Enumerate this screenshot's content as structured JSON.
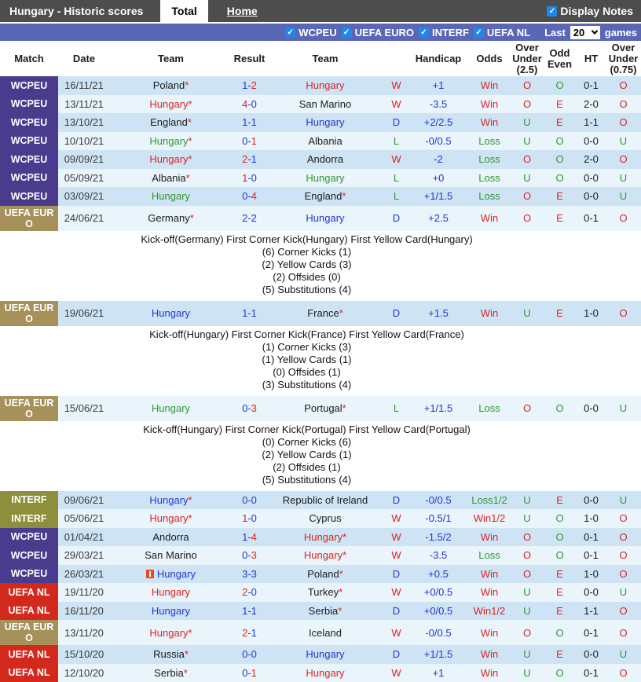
{
  "titlebar": {
    "title": "Hungary - Historic scores",
    "tabs": [
      {
        "label": "Total",
        "active": true
      },
      {
        "label": "Home",
        "active": false
      }
    ],
    "display_notes_label": "Display Notes",
    "display_notes_checked": true
  },
  "filterbar": {
    "leagues": [
      {
        "label": "WCPEU",
        "checked": true
      },
      {
        "label": "UEFA EURO",
        "checked": true
      },
      {
        "label": "INTERF",
        "checked": true
      },
      {
        "label": "UEFA NL",
        "checked": true
      }
    ],
    "last_label": "Last",
    "last_value": "20",
    "games_label": "games"
  },
  "table": {
    "headers": [
      "Match",
      "Date",
      "Team",
      "Result",
      "Team",
      "",
      "Handicap",
      "Odds",
      "Over Under (2.5)",
      "Odd Even",
      "HT",
      "Over Under (0.75)"
    ],
    "rows": [
      {
        "league": "WCPEU",
        "date": "16/11/21",
        "team1": {
          "name": "Poland",
          "color": "black",
          "star": true
        },
        "score": {
          "s1": "1",
          "s2": "2",
          "c1": "blue",
          "c2": "red"
        },
        "team2": {
          "name": "Hungary",
          "color": "red",
          "star": false
        },
        "wdl": {
          "t": "W",
          "c": "red"
        },
        "handicap": "+1",
        "odds": {
          "t": "Win",
          "c": "red"
        },
        "ou25": {
          "t": "O",
          "c": "red"
        },
        "oe": {
          "t": "O",
          "c": "green"
        },
        "ht": "0-1",
        "ou075": {
          "t": "O",
          "c": "red"
        }
      },
      {
        "league": "WCPEU",
        "date": "13/11/21",
        "team1": {
          "name": "Hungary",
          "color": "red",
          "star": true
        },
        "score": {
          "s1": "4",
          "s2": "0",
          "c1": "red",
          "c2": "blue"
        },
        "team2": {
          "name": "San Marino",
          "color": "black",
          "star": false
        },
        "wdl": {
          "t": "W",
          "c": "red"
        },
        "handicap": "-3.5",
        "odds": {
          "t": "Win",
          "c": "red"
        },
        "ou25": {
          "t": "O",
          "c": "red"
        },
        "oe": {
          "t": "E",
          "c": "red"
        },
        "ht": "2-0",
        "ou075": {
          "t": "O",
          "c": "red"
        }
      },
      {
        "league": "WCPEU",
        "date": "13/10/21",
        "team1": {
          "name": "England",
          "color": "black",
          "star": true
        },
        "score": {
          "s1": "1",
          "s2": "1",
          "c1": "blue",
          "c2": "blue"
        },
        "team2": {
          "name": "Hungary",
          "color": "blue",
          "star": false
        },
        "wdl": {
          "t": "D",
          "c": "blue"
        },
        "handicap": "+2/2.5",
        "odds": {
          "t": "Win",
          "c": "red"
        },
        "ou25": {
          "t": "U",
          "c": "green"
        },
        "oe": {
          "t": "E",
          "c": "red"
        },
        "ht": "1-1",
        "ou075": {
          "t": "O",
          "c": "red"
        }
      },
      {
        "league": "WCPEU",
        "date": "10/10/21",
        "team1": {
          "name": "Hungary",
          "color": "green",
          "star": true
        },
        "score": {
          "s1": "0",
          "s2": "1",
          "c1": "blue",
          "c2": "red"
        },
        "team2": {
          "name": "Albania",
          "color": "black",
          "star": false
        },
        "wdl": {
          "t": "L",
          "c": "green"
        },
        "handicap": "-0/0.5",
        "odds": {
          "t": "Loss",
          "c": "green"
        },
        "ou25": {
          "t": "U",
          "c": "green"
        },
        "oe": {
          "t": "O",
          "c": "green"
        },
        "ht": "0-0",
        "ou075": {
          "t": "U",
          "c": "green"
        }
      },
      {
        "league": "WCPEU",
        "date": "09/09/21",
        "team1": {
          "name": "Hungary",
          "color": "red",
          "star": true
        },
        "score": {
          "s1": "2",
          "s2": "1",
          "c1": "red",
          "c2": "blue"
        },
        "team2": {
          "name": "Andorra",
          "color": "black",
          "star": false
        },
        "wdl": {
          "t": "W",
          "c": "red"
        },
        "handicap": "-2",
        "odds": {
          "t": "Loss",
          "c": "green"
        },
        "ou25": {
          "t": "O",
          "c": "red"
        },
        "oe": {
          "t": "O",
          "c": "green"
        },
        "ht": "2-0",
        "ou075": {
          "t": "O",
          "c": "red"
        }
      },
      {
        "league": "WCPEU",
        "date": "05/09/21",
        "team1": {
          "name": "Albania",
          "color": "black",
          "star": true
        },
        "score": {
          "s1": "1",
          "s2": "0",
          "c1": "red",
          "c2": "blue"
        },
        "team2": {
          "name": "Hungary",
          "color": "green",
          "star": false
        },
        "wdl": {
          "t": "L",
          "c": "green"
        },
        "handicap": "+0",
        "odds": {
          "t": "Loss",
          "c": "green"
        },
        "ou25": {
          "t": "U",
          "c": "green"
        },
        "oe": {
          "t": "O",
          "c": "green"
        },
        "ht": "0-0",
        "ou075": {
          "t": "U",
          "c": "green"
        }
      },
      {
        "league": "WCPEU",
        "date": "03/09/21",
        "team1": {
          "name": "Hungary",
          "color": "green",
          "star": false
        },
        "score": {
          "s1": "0",
          "s2": "4",
          "c1": "blue",
          "c2": "red"
        },
        "team2": {
          "name": "England",
          "color": "black",
          "star": true
        },
        "wdl": {
          "t": "L",
          "c": "green"
        },
        "handicap": "+1/1.5",
        "odds": {
          "t": "Loss",
          "c": "green"
        },
        "ou25": {
          "t": "O",
          "c": "red"
        },
        "oe": {
          "t": "E",
          "c": "red"
        },
        "ht": "0-0",
        "ou075": {
          "t": "U",
          "c": "green"
        }
      },
      {
        "league": "UEFA EURO",
        "date": "24/06/21",
        "team1": {
          "name": "Germany",
          "color": "black",
          "star": true
        },
        "score": {
          "s1": "2",
          "s2": "2",
          "c1": "blue",
          "c2": "blue"
        },
        "team2": {
          "name": "Hungary",
          "color": "blue",
          "star": false
        },
        "wdl": {
          "t": "D",
          "c": "blue"
        },
        "handicap": "+2.5",
        "odds": {
          "t": "Win",
          "c": "red"
        },
        "ou25": {
          "t": "O",
          "c": "red"
        },
        "oe": {
          "t": "E",
          "c": "red"
        },
        "ht": "0-1",
        "ou075": {
          "t": "O",
          "c": "red"
        },
        "note": {
          "header": "Kick-off(Germany)  First Corner Kick(Hungary)  First Yellow Card(Hungary)",
          "lines": [
            "(6) Corner Kicks (1)",
            "(2) Yellow Cards (3)",
            "(2) Offsides (0)",
            "(5) Substitutions (4)"
          ]
        }
      },
      {
        "league": "UEFA EURO",
        "date": "19/06/21",
        "team1": {
          "name": "Hungary",
          "color": "blue",
          "star": false
        },
        "score": {
          "s1": "1",
          "s2": "1",
          "c1": "blue",
          "c2": "blue"
        },
        "team2": {
          "name": "France",
          "color": "black",
          "star": true
        },
        "wdl": {
          "t": "D",
          "c": "blue"
        },
        "handicap": "+1.5",
        "odds": {
          "t": "Win",
          "c": "red"
        },
        "ou25": {
          "t": "U",
          "c": "green"
        },
        "oe": {
          "t": "E",
          "c": "red"
        },
        "ht": "1-0",
        "ou075": {
          "t": "O",
          "c": "red"
        },
        "note": {
          "header": "Kick-off(Hungary)  First Corner Kick(France)  First Yellow Card(France)",
          "lines": [
            "(1) Corner Kicks (3)",
            "(1) Yellow Cards (1)",
            "(0) Offsides (1)",
            "(3) Substitutions (4)"
          ]
        }
      },
      {
        "league": "UEFA EURO",
        "date": "15/06/21",
        "team1": {
          "name": "Hungary",
          "color": "green",
          "star": false
        },
        "score": {
          "s1": "0",
          "s2": "3",
          "c1": "blue",
          "c2": "red"
        },
        "team2": {
          "name": "Portugal",
          "color": "black",
          "star": true
        },
        "wdl": {
          "t": "L",
          "c": "green"
        },
        "handicap": "+1/1.5",
        "odds": {
          "t": "Loss",
          "c": "green"
        },
        "ou25": {
          "t": "O",
          "c": "red"
        },
        "oe": {
          "t": "O",
          "c": "green"
        },
        "ht": "0-0",
        "ou075": {
          "t": "U",
          "c": "green"
        },
        "note": {
          "header": "Kick-off(Hungary)  First Corner Kick(Portugal)  First Yellow Card(Portugal)",
          "lines": [
            "(0) Corner Kicks (6)",
            "(2) Yellow Cards (1)",
            "(2) Offsides (1)",
            "(5) Substitutions (4)"
          ]
        }
      },
      {
        "league": "INTERF",
        "date": "09/06/21",
        "team1": {
          "name": "Hungary",
          "color": "blue",
          "star": true
        },
        "score": {
          "s1": "0",
          "s2": "0",
          "c1": "blue",
          "c2": "blue"
        },
        "team2": {
          "name": "Republic of Ireland",
          "color": "black",
          "star": false
        },
        "wdl": {
          "t": "D",
          "c": "blue"
        },
        "handicap": "-0/0.5",
        "odds": {
          "t": "Loss1/2",
          "c": "green"
        },
        "ou25": {
          "t": "U",
          "c": "green"
        },
        "oe": {
          "t": "E",
          "c": "red"
        },
        "ht": "0-0",
        "ou075": {
          "t": "U",
          "c": "green"
        }
      },
      {
        "league": "INTERF",
        "date": "05/06/21",
        "team1": {
          "name": "Hungary",
          "color": "red",
          "star": true
        },
        "score": {
          "s1": "1",
          "s2": "0",
          "c1": "red",
          "c2": "blue"
        },
        "team2": {
          "name": "Cyprus",
          "color": "black",
          "star": false
        },
        "wdl": {
          "t": "W",
          "c": "red"
        },
        "handicap": "-0.5/1",
        "odds": {
          "t": "Win1/2",
          "c": "red"
        },
        "ou25": {
          "t": "U",
          "c": "green"
        },
        "oe": {
          "t": "O",
          "c": "green"
        },
        "ht": "1-0",
        "ou075": {
          "t": "O",
          "c": "red"
        }
      },
      {
        "league": "WCPEU",
        "date": "01/04/21",
        "team1": {
          "name": "Andorra",
          "color": "black",
          "star": false
        },
        "score": {
          "s1": "1",
          "s2": "4",
          "c1": "blue",
          "c2": "red"
        },
        "team2": {
          "name": "Hungary",
          "color": "red",
          "star": true
        },
        "wdl": {
          "t": "W",
          "c": "red"
        },
        "handicap": "-1.5/2",
        "odds": {
          "t": "Win",
          "c": "red"
        },
        "ou25": {
          "t": "O",
          "c": "red"
        },
        "oe": {
          "t": "O",
          "c": "green"
        },
        "ht": "0-1",
        "ou075": {
          "t": "O",
          "c": "red"
        }
      },
      {
        "league": "WCPEU",
        "date": "29/03/21",
        "team1": {
          "name": "San Marino",
          "color": "black",
          "star": false
        },
        "score": {
          "s1": "0",
          "s2": "3",
          "c1": "blue",
          "c2": "red"
        },
        "team2": {
          "name": "Hungary",
          "color": "red",
          "star": true
        },
        "wdl": {
          "t": "W",
          "c": "red"
        },
        "handicap": "-3.5",
        "odds": {
          "t": "Loss",
          "c": "green"
        },
        "ou25": {
          "t": "O",
          "c": "red"
        },
        "oe": {
          "t": "O",
          "c": "green"
        },
        "ht": "0-1",
        "ou075": {
          "t": "O",
          "c": "red"
        }
      },
      {
        "league": "WCPEU",
        "date": "26/03/21",
        "team1": {
          "name": "Hungary",
          "color": "blue",
          "star": false,
          "red_card": true
        },
        "score": {
          "s1": "3",
          "s2": "3",
          "c1": "blue",
          "c2": "blue"
        },
        "team2": {
          "name": "Poland",
          "color": "black",
          "star": true
        },
        "wdl": {
          "t": "D",
          "c": "blue"
        },
        "handicap": "+0.5",
        "odds": {
          "t": "Win",
          "c": "red"
        },
        "ou25": {
          "t": "O",
          "c": "red"
        },
        "oe": {
          "t": "E",
          "c": "red"
        },
        "ht": "1-0",
        "ou075": {
          "t": "O",
          "c": "red"
        }
      },
      {
        "league": "UEFA NL",
        "date": "19/11/20",
        "team1": {
          "name": "Hungary",
          "color": "red",
          "star": false
        },
        "score": {
          "s1": "2",
          "s2": "0",
          "c1": "red",
          "c2": "blue"
        },
        "team2": {
          "name": "Turkey",
          "color": "black",
          "star": true
        },
        "wdl": {
          "t": "W",
          "c": "red"
        },
        "handicap": "+0/0.5",
        "odds": {
          "t": "Win",
          "c": "red"
        },
        "ou25": {
          "t": "U",
          "c": "green"
        },
        "oe": {
          "t": "E",
          "c": "red"
        },
        "ht": "0-0",
        "ou075": {
          "t": "U",
          "c": "green"
        }
      },
      {
        "league": "UEFA NL",
        "date": "16/11/20",
        "team1": {
          "name": "Hungary",
          "color": "blue",
          "star": false
        },
        "score": {
          "s1": "1",
          "s2": "1",
          "c1": "blue",
          "c2": "blue"
        },
        "team2": {
          "name": "Serbia",
          "color": "black",
          "star": true
        },
        "wdl": {
          "t": "D",
          "c": "blue"
        },
        "handicap": "+0/0.5",
        "odds": {
          "t": "Win1/2",
          "c": "red"
        },
        "ou25": {
          "t": "U",
          "c": "green"
        },
        "oe": {
          "t": "E",
          "c": "red"
        },
        "ht": "1-1",
        "ou075": {
          "t": "O",
          "c": "red"
        }
      },
      {
        "league": "UEFA EURO",
        "date": "13/11/20",
        "team1": {
          "name": "Hungary",
          "color": "red",
          "star": true
        },
        "score": {
          "s1": "2",
          "s2": "1",
          "c1": "red",
          "c2": "blue"
        },
        "team2": {
          "name": "Iceland",
          "color": "black",
          "star": false
        },
        "wdl": {
          "t": "W",
          "c": "red"
        },
        "handicap": "-0/0.5",
        "odds": {
          "t": "Win",
          "c": "red"
        },
        "ou25": {
          "t": "O",
          "c": "red"
        },
        "oe": {
          "t": "O",
          "c": "green"
        },
        "ht": "0-1",
        "ou075": {
          "t": "O",
          "c": "red"
        }
      },
      {
        "league": "UEFA NL",
        "date": "15/10/20",
        "team1": {
          "name": "Russia",
          "color": "black",
          "star": true
        },
        "score": {
          "s1": "0",
          "s2": "0",
          "c1": "blue",
          "c2": "blue"
        },
        "team2": {
          "name": "Hungary",
          "color": "blue",
          "star": false
        },
        "wdl": {
          "t": "D",
          "c": "blue"
        },
        "handicap": "+1/1.5",
        "odds": {
          "t": "Win",
          "c": "red"
        },
        "ou25": {
          "t": "U",
          "c": "green"
        },
        "oe": {
          "t": "E",
          "c": "red"
        },
        "ht": "0-0",
        "ou075": {
          "t": "U",
          "c": "green"
        }
      },
      {
        "league": "UEFA NL",
        "date": "12/10/20",
        "team1": {
          "name": "Serbia",
          "color": "black",
          "star": true
        },
        "score": {
          "s1": "0",
          "s2": "1",
          "c1": "blue",
          "c2": "red"
        },
        "team2": {
          "name": "Hungary",
          "color": "red",
          "star": false
        },
        "wdl": {
          "t": "W",
          "c": "red"
        },
        "handicap": "+1",
        "odds": {
          "t": "Win",
          "c": "red"
        },
        "ou25": {
          "t": "U",
          "c": "green"
        },
        "oe": {
          "t": "O",
          "c": "green"
        },
        "ht": "0-1",
        "ou075": {
          "t": "O",
          "c": "red"
        }
      }
    ]
  },
  "colors": {
    "titlebar_bg": "#4d4d4d",
    "filterbar_bg": "#5a67b5",
    "checkbox_blue": "#1f88e8",
    "league_wcpeu": "#4a3b8d",
    "league_uefa_euro": "#a6915a",
    "league_interf": "#8e8f3a",
    "league_uefa_nl": "#d3291d",
    "row_dark": "#cee4f4",
    "row_light": "#e9f4fb",
    "text_win_red": "#df2222",
    "text_draw_blue": "#2336cc",
    "text_loss_green": "#2f992f"
  }
}
